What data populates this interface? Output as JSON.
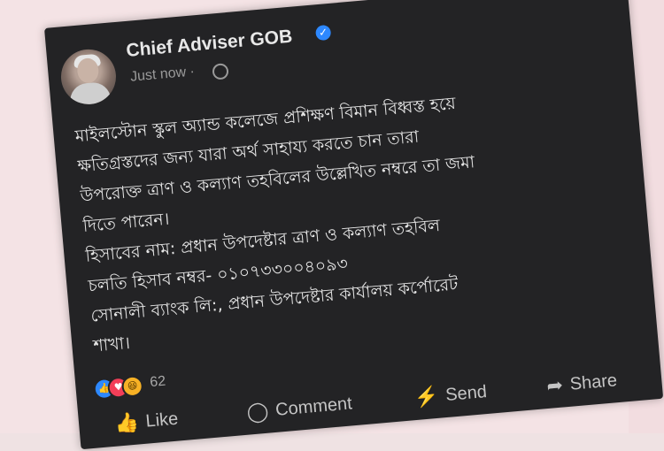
{
  "post": {
    "author": "Chief Adviser GOB",
    "timestamp": "Just now ·",
    "text": "মাইলস্টোন স্কুল অ্যান্ড কলেজে প্রশিক্ষণ বিমান বিধ্বস্ত হয়ে\nক্ষতিগ্রস্তদের জন্য যারা অর্থ সাহায্য করতে চান তারা\nউপরোক্ত ত্রাণ ও কল্যাণ তহবিলের উল্লেখিত নম্বরে তা জমা\nদিতে পারেন।\nহিসাবের নাম: প্রধান উপদেষ্টার ত্রাণ ও কল্যাণ তহবিল\nচলতি হিসাব নম্বর- ০১০৭৩৩০০৪০৯৩\nসোনালী ব্যাংক লি:, প্রধান উপদেষ্টার কার্যালয় কর্পোরেট\nশাখা।"
  },
  "reactions": {
    "count": "62"
  },
  "actions": {
    "like": "Like",
    "comment": "Comment",
    "send": "Send",
    "share": "Share"
  },
  "icons": {
    "verified": "verified-badge",
    "globe": "globe-icon",
    "more": "more-icon",
    "close": "close-icon"
  },
  "colors": {
    "card": "#232325",
    "accent": "#2d88ff"
  }
}
